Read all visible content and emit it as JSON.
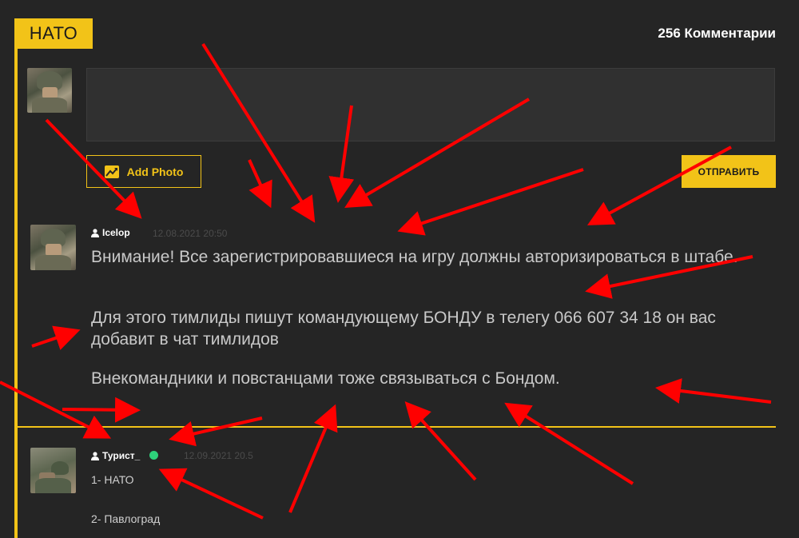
{
  "section": {
    "tag": "НАТО",
    "comments_count": "256 Комментарии"
  },
  "composer": {
    "add_photo_label": "Add Photo",
    "add_photo_icon": "image-chart-icon",
    "send_label": "ОТПРАВИТЬ"
  },
  "comments": [
    {
      "author": "Icelop",
      "date": "12.08.2021 20:50",
      "paragraphs": [
        "Внимание! Все зарегистрировавшиеся на игру должны авторизироваться в штабе.",
        "Для этого тимлиды пишут командующему БОНДУ в телегу 066 607 34 18 он вас добавит в чат тимлидов",
        "Внекомандники и повстанцами тоже связываться с Бондом."
      ]
    },
    {
      "author": "Турист_",
      "date": "12.09.2021 20.5",
      "online": true,
      "paragraphs": [
        "1- НАТО",
        "2- Павлоград"
      ]
    }
  ],
  "colors": {
    "accent": "#f2c318",
    "background": "#252525",
    "arrow": "#ff0000",
    "online": "#2ed17a"
  }
}
